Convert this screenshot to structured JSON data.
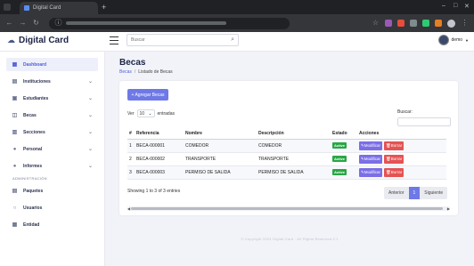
{
  "browser": {
    "tab_title": "Digital Card",
    "new_tab_symbol": "+",
    "window_controls": [
      "–",
      "□",
      "✕"
    ]
  },
  "header": {
    "brand": "Digital Card",
    "search_placeholder": "Buscar",
    "user": "demo"
  },
  "sidebar": {
    "items": [
      {
        "label": "Dashboard",
        "icon": "dashboard-icon",
        "active": true,
        "chevron": false
      },
      {
        "label": "Instituciones",
        "icon": "institution-icon",
        "active": false,
        "chevron": true
      },
      {
        "label": "Estudiantes",
        "icon": "students-icon",
        "active": false,
        "chevron": true
      },
      {
        "label": "Becas",
        "icon": "scholarship-icon",
        "active": false,
        "chevron": true
      },
      {
        "label": "Secciones",
        "icon": "sections-icon",
        "active": false,
        "chevron": true
      },
      {
        "label": "Personal",
        "icon": "person-icon",
        "active": false,
        "chevron": true
      },
      {
        "label": "Informes",
        "icon": "reports-icon",
        "active": false,
        "chevron": true
      }
    ],
    "section_label": "ADMINISTRACIÓN",
    "admin_items": [
      {
        "label": "Paquetes",
        "icon": "packages-icon"
      },
      {
        "label": "Usuarios",
        "icon": "users-icon"
      },
      {
        "label": "Entidad",
        "icon": "entity-icon"
      }
    ]
  },
  "page": {
    "title": "Becas",
    "breadcrumb": [
      "Becas",
      "Listado de Becas"
    ],
    "add_button": "+ Agregar Becas",
    "show_label": "Ver",
    "entries_label": "entradas",
    "page_length": "10",
    "search_label": "Buscar:"
  },
  "table": {
    "columns": [
      "#",
      "Referencia",
      "Nombre",
      "Descripción",
      "Estado",
      "Acciones"
    ],
    "rows": [
      {
        "n": "1",
        "ref": "BECA-000001",
        "name": "COMEDOR",
        "desc": "COMEDOR",
        "status": "Active"
      },
      {
        "n": "2",
        "ref": "BECA-000002",
        "name": "TRANSPORTE",
        "desc": "TRANSPORTE",
        "status": "Active"
      },
      {
        "n": "3",
        "ref": "BECA-000003",
        "name": "PERMISO DE SALIDA",
        "desc": "PERMISO DE SALIDA",
        "status": "Active"
      }
    ],
    "edit_label": "Modificar",
    "delete_label": "Borrar",
    "info": "Showing 1 to 3 of 3 entries",
    "pagination": [
      "Anterior",
      "1",
      "Siguiente"
    ]
  },
  "footer": "© Copyright 2024 Digital Card · All Rights Reserved 2.1"
}
